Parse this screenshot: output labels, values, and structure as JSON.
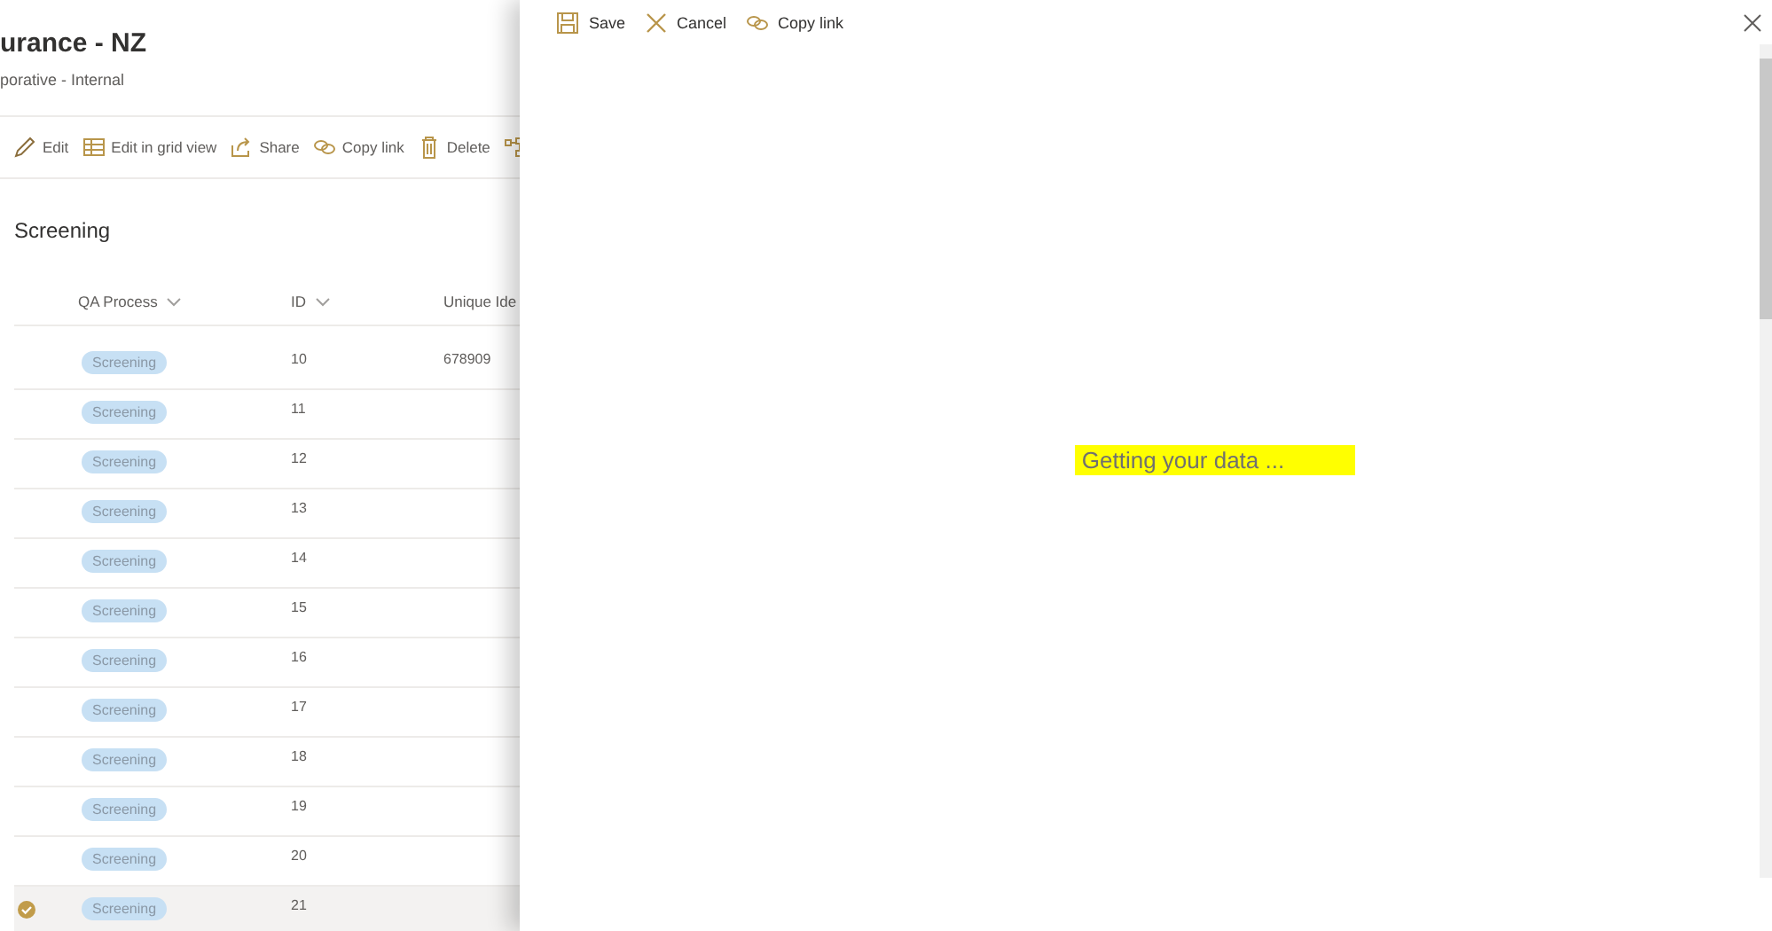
{
  "list": {
    "title": "urance - NZ",
    "subtitle": "porative - Internal",
    "toolbar": [
      {
        "kind": "edit",
        "label": "Edit"
      },
      {
        "kind": "grid",
        "label": "Edit in grid view"
      },
      {
        "kind": "share",
        "label": "Share"
      },
      {
        "kind": "link",
        "label": "Copy link"
      },
      {
        "kind": "delete",
        "label": "Delete"
      },
      {
        "kind": "flow"
      }
    ],
    "view_title": "Screening",
    "columns": [
      "QA Process",
      "ID",
      "Unique Ide"
    ],
    "rows": [
      {
        "qa_process": "Screening",
        "id": "10",
        "unique_id": "678909",
        "selected": false
      },
      {
        "qa_process": "Screening",
        "id": "11",
        "selected": false
      },
      {
        "qa_process": "Screening",
        "id": "12",
        "selected": false
      },
      {
        "qa_process": "Screening",
        "id": "13",
        "selected": false
      },
      {
        "qa_process": "Screening",
        "id": "14",
        "selected": false
      },
      {
        "qa_process": "Screening",
        "id": "15",
        "selected": false
      },
      {
        "qa_process": "Screening",
        "id": "16",
        "selected": false
      },
      {
        "qa_process": "Screening",
        "id": "17",
        "selected": false
      },
      {
        "qa_process": "Screening",
        "id": "18",
        "selected": false
      },
      {
        "qa_process": "Screening",
        "id": "19",
        "selected": false
      },
      {
        "qa_process": "Screening",
        "id": "20",
        "selected": false
      },
      {
        "qa_process": "Screening",
        "id": "21",
        "selected": true
      }
    ]
  },
  "panel": {
    "commands": [
      {
        "kind": "save",
        "label": "Save"
      },
      {
        "kind": "cancel",
        "label": "Cancel"
      },
      {
        "kind": "link",
        "label": "Copy link"
      }
    ],
    "loading_text": "Getting your data ..."
  }
}
